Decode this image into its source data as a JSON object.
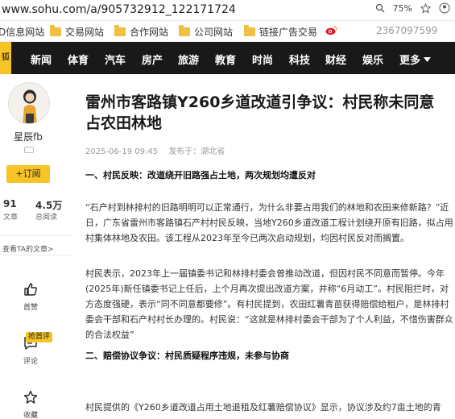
{
  "browser": {
    "url": "www.sohu.com/a/905732912_122171724",
    "zoom": "75%"
  },
  "bookmarks": {
    "items": [
      "D信息网站",
      "交易网站",
      "合作网站",
      "公司网站",
      "链接广告交易"
    ],
    "right_text": "2367097599"
  },
  "nav": {
    "logo": "狐",
    "items": [
      "新闻",
      "体育",
      "汽车",
      "房产",
      "旅游",
      "教育",
      "时尚",
      "科技",
      "财经",
      "娱乐",
      "更多"
    ]
  },
  "author": {
    "name": "星辰fb",
    "follow_label": "+订阅",
    "stats": [
      {
        "value": "91",
        "label": "文章"
      },
      {
        "value": "4.5万",
        "label": "总阅读"
      }
    ],
    "view_articles": "查看TA的文章>",
    "actions": [
      {
        "label": "首赞",
        "icon": "thumbs-up-icon"
      },
      {
        "label": "评论",
        "icon": "comment-icon",
        "tag": "抢首评"
      },
      {
        "label": "收藏",
        "icon": "star-icon"
      }
    ]
  },
  "article": {
    "title": "雷州市客路镇Y260乡道改道引争议：村民称未同意占农田林地",
    "date": "2025-06-19 09:45",
    "source": "发布于：湖北省",
    "paragraphs": [
      {
        "type": "heading",
        "text": "一、村民反映：改道绕开旧路强占土地，两次规划均遭反对"
      },
      {
        "type": "text",
        "text": "“石产村到林排村的旧路明明可以正常通行，为什么非要占用我们的林地和农田来修新路？”近日，广东省雷州市客路镇石产村村民反映，当地Y260乡道改道工程计划绕开原有旧路，拟占用村集体林地及农田。该工程从2023年至今已两次启动规划，均因村民反对而搁置。"
      },
      {
        "type": "text",
        "text": "村民表示，2023年上一届镇委书记和林排村委会曾推动改道，但因村民不同意而暂停。今年(2025年)新任镇委书记上任后，上个月再次提出改道方案，并称“6月动工”。村民阻拦时，对方态度强硬，表示“同不同意都要修”。有村民提到，农田红薯青苗获得赔偿给租户，是林排村委会干部和石产村村长办理的。村民说：“这就是林排村委会干部为了个人利益，不惜伤害群众的合法权益”"
      },
      {
        "type": "heading",
        "text": "二、赔偿协议争议：村民质疑程序违规，未参与协商"
      },
      {
        "type": "text",
        "text": "村民提供的《Y260乡道改道占用土地退租及红薯赔偿协议》显示，协议涉及约7亩土地的青"
      }
    ]
  },
  "colors": {
    "accent": "#f6c427",
    "nav_bg": "#191919"
  }
}
